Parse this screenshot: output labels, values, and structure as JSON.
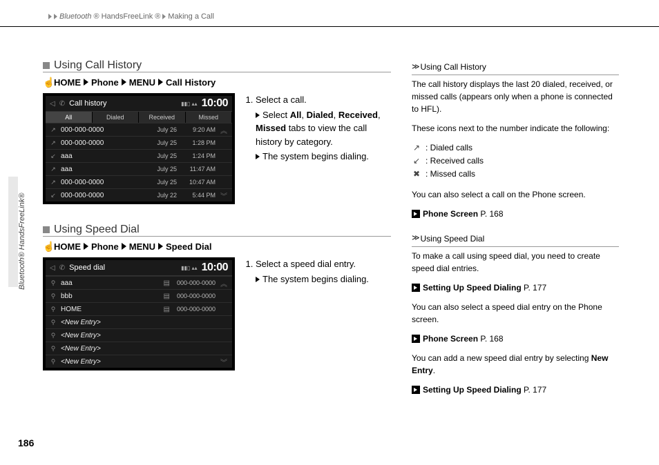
{
  "breadcrumb": {
    "part1": "Bluetooth",
    "reg": "®",
    "part2": "HandsFreeLink",
    "part3": "Making a Call"
  },
  "sidetab": "Bluetooth® HandsFreeLink®",
  "page_number": "186",
  "section1": {
    "title": "Using Call History",
    "nav": {
      "home": "HOME",
      "phone": "Phone",
      "menu": "MENU",
      "leaf": "Call History"
    },
    "screen": {
      "title": "Call history",
      "signal": "📶",
      "time": "10:00",
      "tabs": [
        "All",
        "Dialed",
        "Received",
        "Missed"
      ],
      "rows": [
        {
          "icon": "↗",
          "num": "000-000-0000",
          "date": "July 26",
          "time": "9:20 AM"
        },
        {
          "icon": "↗",
          "num": "000-000-0000",
          "date": "July 25",
          "time": "1:28 PM"
        },
        {
          "icon": "↙",
          "num": "aaa",
          "date": "July 25",
          "time": "1:24 PM"
        },
        {
          "icon": "↗",
          "num": "aaa",
          "date": "July 25",
          "time": "11:47 AM"
        },
        {
          "icon": "↗",
          "num": "000-000-0000",
          "date": "July 25",
          "time": "10:47 AM"
        },
        {
          "icon": "↙",
          "num": "000-000-0000",
          "date": "July 22",
          "time": "5:44 PM"
        }
      ]
    },
    "steps": {
      "s1": "Select a call.",
      "s1a_pre": "Select ",
      "s1a_b1": "All",
      "s1a_b2": "Dialed",
      "s1a_b3": "Received",
      "s1a_b4": "Missed",
      "s1a_post": " tabs to view the call history by category.",
      "s1b": "The system begins dialing."
    }
  },
  "section2": {
    "title": "Using Speed Dial",
    "nav": {
      "home": "HOME",
      "phone": "Phone",
      "menu": "MENU",
      "leaf": "Speed Dial"
    },
    "screen": {
      "title": "Speed dial",
      "time": "10:00",
      "rows": [
        {
          "icon": "⚲",
          "name": "aaa",
          "phone": "000-000-0000"
        },
        {
          "icon": "⚲",
          "name": "bbb",
          "phone": "000-000-0000"
        },
        {
          "icon": "⚲",
          "name": "HOME",
          "phone": "000-000-0000"
        },
        {
          "icon": "⚲",
          "name": "<New Entry>",
          "phone": ""
        },
        {
          "icon": "⚲",
          "name": "<New Entry>",
          "phone": ""
        },
        {
          "icon": "⚲",
          "name": "<New Entry>",
          "phone": ""
        },
        {
          "icon": "⚲",
          "name": "<New Entry>",
          "phone": ""
        }
      ]
    },
    "steps": {
      "s1": "Select a speed dial entry.",
      "s1a": "The system begins dialing."
    }
  },
  "side1": {
    "title": "Using Call History",
    "p1": "The call history displays the last 20 dialed, received, or missed calls (appears only when a phone is connected to HFL).",
    "p2": "These icons next to the number indicate the following:",
    "icons": [
      {
        "g": "↗",
        "txt": ": Dialed calls"
      },
      {
        "g": "↙",
        "txt": ": Received calls"
      },
      {
        "g": "✖",
        "txt": ": Missed calls"
      }
    ],
    "p3": "You can also select a call on the Phone screen.",
    "link1_label": "Phone Screen",
    "link1_page": "P. 168"
  },
  "side2": {
    "title": "Using Speed Dial",
    "p1": "To make a call using speed dial, you need to create speed dial entries.",
    "link1_label": "Setting Up Speed Dialing",
    "link1_page": "P. 177",
    "p2": "You can also select a speed dial entry on the Phone screen.",
    "link2_label": "Phone Screen",
    "link2_page": "P. 168",
    "p3_pre": "You can add a new speed dial entry by selecting ",
    "p3_b": "New Entry",
    "p3_post": ".",
    "link3_label": "Setting Up Speed Dialing",
    "link3_page": "P. 177"
  }
}
